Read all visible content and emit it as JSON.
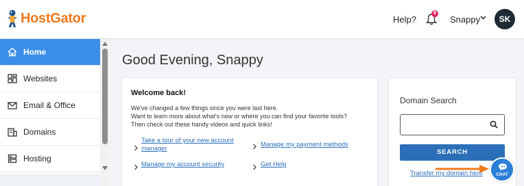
{
  "header": {
    "logo_text": "HostGator",
    "help_label": "Help?",
    "notification_count": "9",
    "user_name": "Snappy",
    "avatar_initials": "SK"
  },
  "sidebar": {
    "items": [
      {
        "label": "Home",
        "icon": "home-icon"
      },
      {
        "label": "Websites",
        "icon": "websites-icon"
      },
      {
        "label": "Email & Office",
        "icon": "envelope-icon"
      },
      {
        "label": "Domains",
        "icon": "building-icon"
      },
      {
        "label": "Hosting",
        "icon": "server-icon"
      }
    ]
  },
  "main": {
    "greeting": "Good Evening, Snappy",
    "welcome": {
      "title": "Welcome back!",
      "line1": "We've changed a few things since you were last here.",
      "line2": "Want to learn more about what's new or where you can find your favorite tools?",
      "line3": "Then check out these handy videos and quick links!",
      "links": {
        "tour_line1": "Take a tour of your new account",
        "tour_line2": "manager",
        "payment": "Manage my payment methods",
        "security": "Manage my account security",
        "help": "Get Help"
      }
    },
    "domain_search": {
      "title": "Domain Search",
      "input_value": "",
      "button_label": "SEARCH",
      "transfer_link": "Transfer my domain here"
    }
  },
  "chat": {
    "label": "CHAT"
  },
  "colors": {
    "brand_orange": "#f07a1d",
    "active_blue": "#3b8fe8",
    "button_blue": "#2b6fb8",
    "link_blue": "#2a6ebb",
    "badge_red": "#e0245e"
  }
}
